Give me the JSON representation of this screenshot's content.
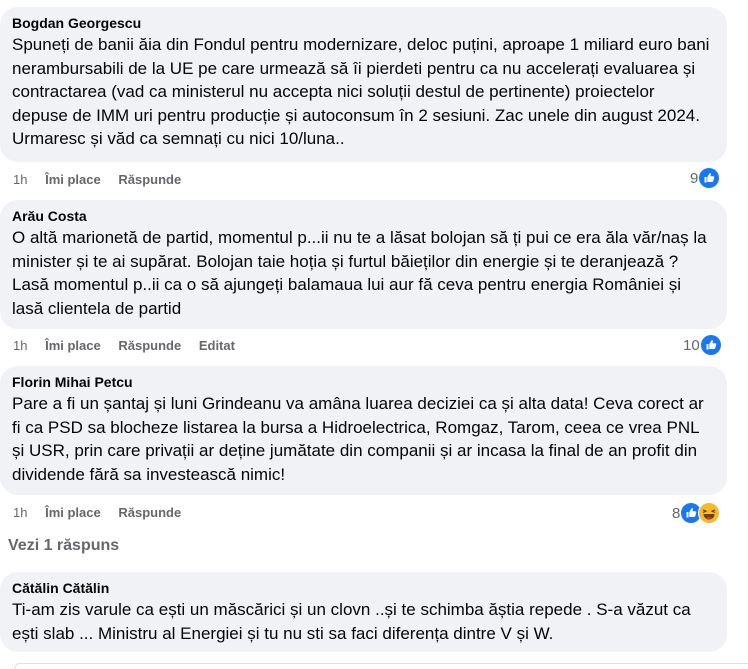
{
  "comments": [
    {
      "author": "Bogdan Georgescu",
      "text": "Spuneți de banii ăia din Fondul pentru modernizare, deloc puțini, aproape 1 miliard euro bani nerambursabili de la UE pe care urmează să îi pierdeti pentru ca nu accelerați evaluarea și contractarea (vad ca ministerul nu accepta nici soluții destul de pertinente) proiectelor depuse de IMM uri pentru producție și autoconsum în 2 sesiuni. Zac unele din august 2024. Urmaresc și văd ca semnați cu nici 10/luna..",
      "time": "1h",
      "like_label": "Îmi place",
      "reply_label": "Răspunde",
      "edited_label": "",
      "reaction_count": "9"
    },
    {
      "author": "Arău Costa",
      "text": "O altă marionetă de partid, momentul p...ii nu te a lăsat bolojan să ți pui ce era ăla văr/naș la minister și te ai supărat. Bolojan taie hoția și furtul băieților din energie și te deranjează ? Lasă momentul p..ii ca o să ajungeți balamaua lui aur fă ceva pentru energia României și lasă clientela de partid",
      "time": "1h",
      "like_label": "Îmi place",
      "reply_label": "Răspunde",
      "edited_label": "Editat",
      "reaction_count": "10"
    },
    {
      "author": "Florin Mihai Petcu",
      "text": "Pare a fi un șantaj și luni Grindeanu va amâna luarea deciziei ca și alta data! Ceva corect ar fi ca PSD sa blocheze listarea la bursa a Hidroelectrica, Romgaz, Tarom, ceea ce vrea PNL și USR, prin care privații ar deține jumătate din companii și ar incasa la final de an profit din dividende fără sa investească nimic!",
      "time": "1h",
      "like_label": "Îmi place",
      "reply_label": "Răspunde",
      "edited_label": "",
      "reaction_count": "8"
    },
    {
      "author": "Cătălin Cătălin",
      "text": "Ti-am zis varule ca ești un măscărici și un clovn ..și te schimba ăștia repede . S-a văzut ca ești slab ... Ministru al Energiei și tu nu sti sa faci diferența dintre V și W."
    }
  ],
  "view_replies_label": "Vezi 1 răspuns",
  "colors": {
    "like_blue": "#1877f2",
    "bubble_bg": "#f0f2f5",
    "meta_gray": "#65676b",
    "haha_yellow": "#f7b928"
  },
  "icons": {
    "like": "like-thumb-icon",
    "haha": "haha-emoji-icon"
  }
}
